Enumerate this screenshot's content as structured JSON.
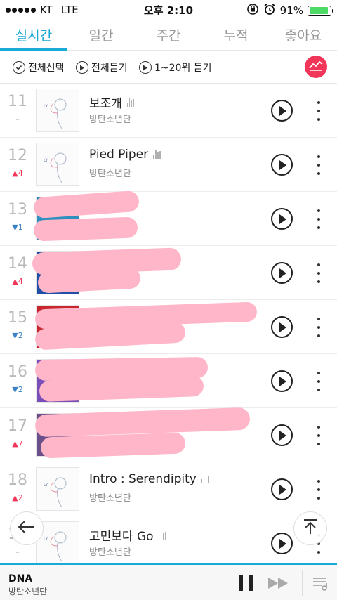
{
  "status": {
    "carrier": "KT",
    "network": "LTE",
    "time": "오후 2:10",
    "battery": "91%",
    "battery_level": 0.91
  },
  "tabs": [
    {
      "label": "실시간"
    },
    {
      "label": "일간"
    },
    {
      "label": "주간"
    },
    {
      "label": "누적"
    },
    {
      "label": "좋아요"
    }
  ],
  "actions": {
    "select_all": "전체선택",
    "play_all": "전체듣기",
    "play_top": "1~20위 듣기"
  },
  "tracks": [
    {
      "rank": "11",
      "change": "–",
      "title": "보조개",
      "artist": "방탄소년단"
    },
    {
      "rank": "12",
      "change": "▲4",
      "title": "Pied Piper",
      "artist": "방탄소년단"
    },
    {
      "rank": "13",
      "change": "▼1",
      "title": "",
      "artist": ""
    },
    {
      "rank": "14",
      "change": "▲4",
      "title": "",
      "artist": ""
    },
    {
      "rank": "15",
      "change": "▼2",
      "title": "",
      "artist": ""
    },
    {
      "rank": "16",
      "change": "▼2",
      "title": "",
      "artist": ""
    },
    {
      "rank": "17",
      "change": "▲7",
      "title": "",
      "artist": ""
    },
    {
      "rank": "18",
      "change": "▲2",
      "title": "Intro : Serendipity",
      "artist": "방탄소년단"
    },
    {
      "rank": "19",
      "change": "–",
      "title": "고민보다 Go",
      "artist": "방탄소년단"
    }
  ],
  "player": {
    "title": "DNA",
    "artist": "방탄소년단"
  },
  "colors": {
    "accent": "#19a9d6",
    "chart_button": "#f2365a",
    "up": "#f2365a",
    "down": "#3b82c4",
    "redaction": "#ffb6c8"
  },
  "icons": [
    "check-circle-icon",
    "play-circle-icon",
    "chart-line-icon",
    "play-icon",
    "more-vertical-icon",
    "back-arrow-icon",
    "scroll-top-icon",
    "pause-icon",
    "next-icon",
    "playlist-icon"
  ]
}
